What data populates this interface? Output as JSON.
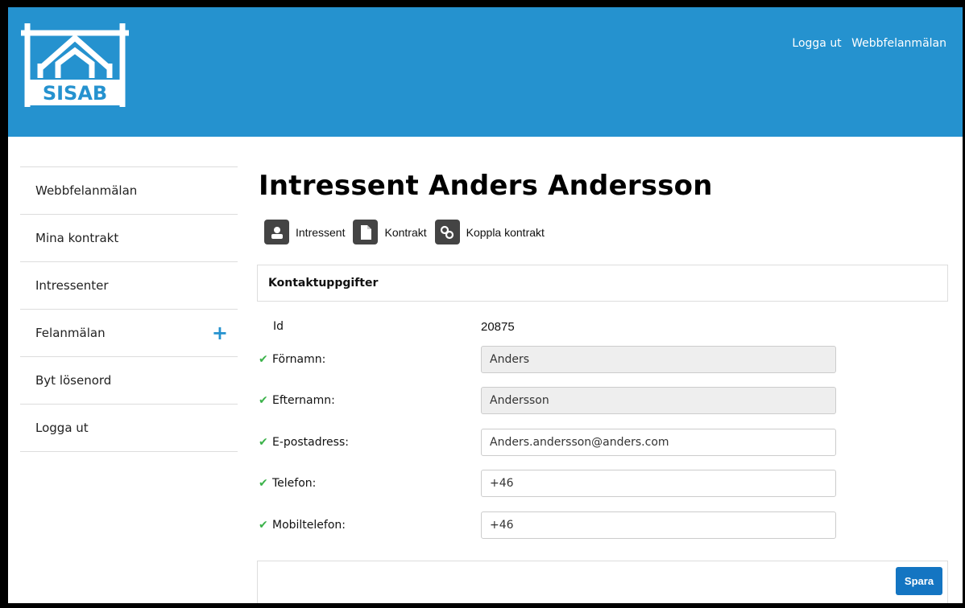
{
  "header": {
    "logo_text": "SISAB",
    "links": [
      "Logga ut",
      "Webbfelanmälan"
    ],
    "color": "#2592cf"
  },
  "sidebar": {
    "items": [
      {
        "label": "Webbfelanmälan"
      },
      {
        "label": "Mina kontrakt"
      },
      {
        "label": "Intressenter"
      },
      {
        "label": "Felanmälan",
        "icon": "plus-icon"
      },
      {
        "label": "Byt lösenord"
      },
      {
        "label": "Logga ut"
      }
    ]
  },
  "main": {
    "title": "Intressent Anders Andersson",
    "tabs": [
      {
        "label": "Intressent",
        "icon": "user-icon"
      },
      {
        "label": "Kontrakt",
        "icon": "document-icon"
      },
      {
        "label": "Koppla kontrakt",
        "icon": "link-icon"
      }
    ],
    "section_title": "Kontaktuppgifter",
    "id_label": "Id",
    "id_value": "20875",
    "fields": [
      {
        "label": "Förnamn:",
        "value": "Anders",
        "readonly": true
      },
      {
        "label": "Efternamn:",
        "value": "Andersson",
        "readonly": true
      },
      {
        "label": "E-postadress:",
        "value": "Anders.andersson@anders.com",
        "readonly": false
      },
      {
        "label": "Telefon:",
        "value": "+46",
        "readonly": false
      },
      {
        "label": "Mobiltelefon:",
        "value": "+46",
        "readonly": false
      }
    ],
    "save_label": "Spara"
  },
  "colors": {
    "accent": "#2592cf",
    "check": "#3bb24a",
    "button": "#1475c2"
  }
}
